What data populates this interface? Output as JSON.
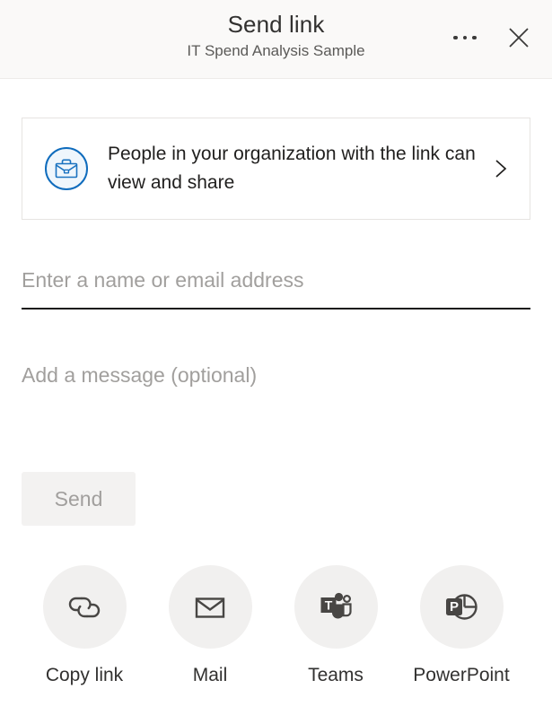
{
  "header": {
    "title": "Send link",
    "subtitle": "IT Spend Analysis Sample",
    "more_label": "More options",
    "close_label": "Close"
  },
  "permission": {
    "icon": "briefcase-icon",
    "line1": "People in your organization with the link",
    "line2": "can view and share",
    "chevron": "chevron-right-icon"
  },
  "recipient": {
    "placeholder": "Enter a name or email address",
    "value": ""
  },
  "message": {
    "placeholder": "Add a message (optional)",
    "value": ""
  },
  "send": {
    "label": "Send",
    "disabled": true
  },
  "actions": [
    {
      "label": "Copy link",
      "icon": "link-icon"
    },
    {
      "label": "Mail",
      "icon": "mail-icon"
    },
    {
      "label": "Teams",
      "icon": "teams-icon"
    },
    {
      "label": "PowerPoint",
      "icon": "powerpoint-icon"
    }
  ],
  "colors": {
    "header_bg": "#faf9f8",
    "accent_blue": "#0f6cbd",
    "icon_dark": "#484644",
    "circle_bg": "#f1f0ef",
    "disabled_text": "#a19f9d"
  }
}
